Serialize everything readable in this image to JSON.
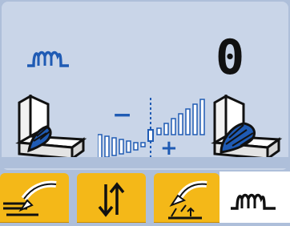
{
  "display": {
    "counter_value": "0",
    "bg_color": "#c9d5e8",
    "accent_color": "#1f5bb4",
    "tab_color": "#f4b818"
  },
  "scale": {
    "minus_label": "−",
    "plus_label": "+"
  },
  "icons": {
    "mode": "weave-icon",
    "left": "fillet-weld-narrow-icon",
    "right": "fillet-weld-wide-icon",
    "tabs": [
      "torch-wire-icon",
      "up-down-arrows-icon",
      "torch-height-icon",
      "weave-icon"
    ]
  }
}
